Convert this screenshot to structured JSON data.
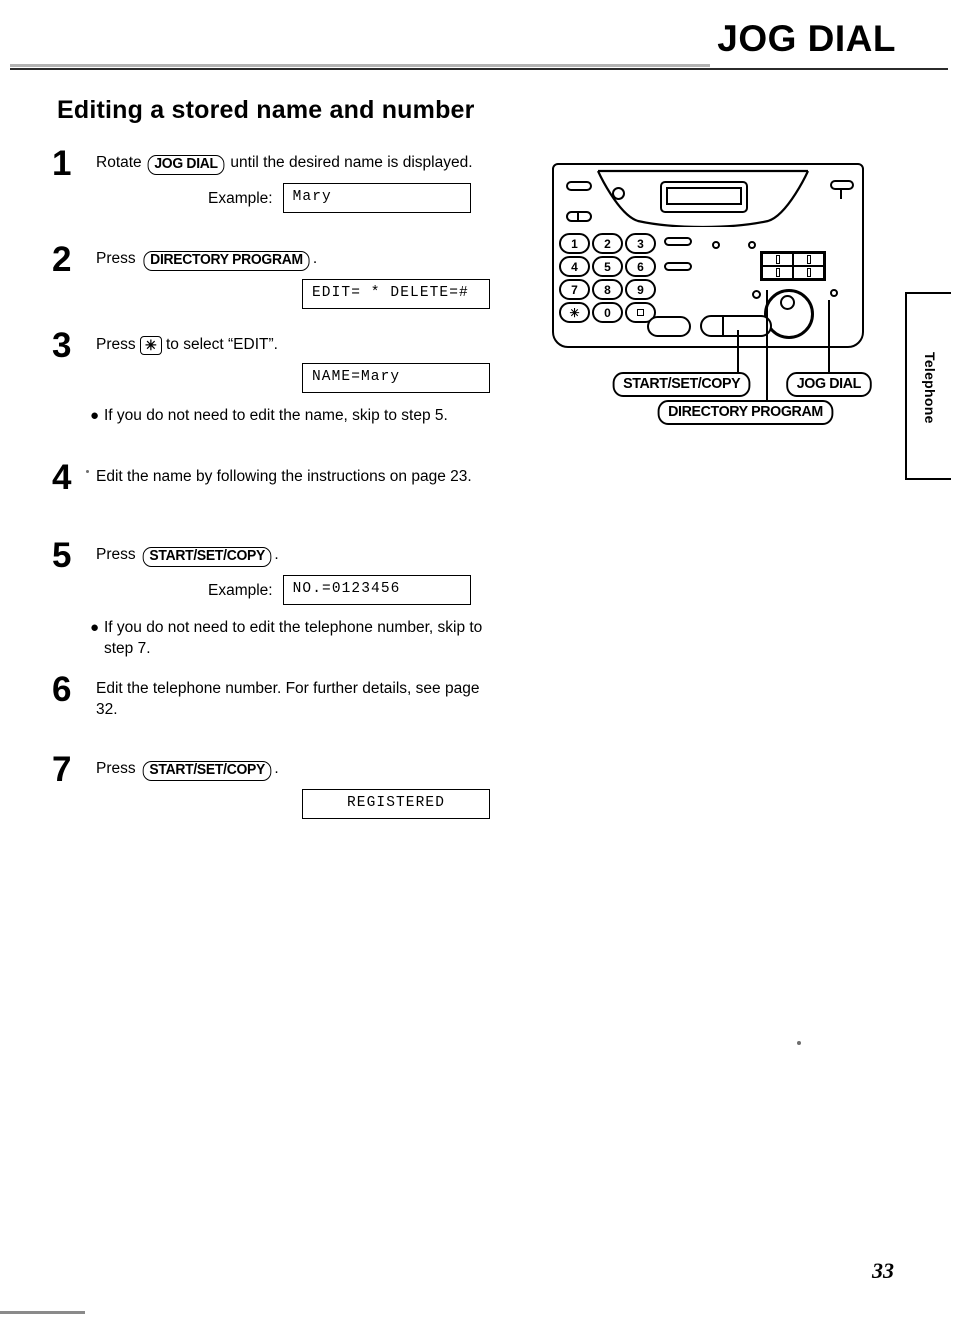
{
  "header": {
    "title": "JOG DIAL"
  },
  "section": {
    "title": "Editing a stored name and number"
  },
  "steps": [
    {
      "number": "1",
      "text_before": "Rotate",
      "key": "JOG DIAL",
      "text_after": "until the desired name is displayed.",
      "example_label": "Example:",
      "lcd": "Mary",
      "lcd_align": "left"
    },
    {
      "number": "2",
      "text_before": "Press",
      "key": "DIRECTORY PROGRAM",
      "text_after": ".",
      "lcd": "EDIT= * DELETE=#",
      "lcd_align": "left"
    },
    {
      "number": "3",
      "text_before": "Press",
      "key": "✳",
      "text_after": "to select “EDIT”.",
      "lcd": "NAME=Mary",
      "lcd_align": "left",
      "note": "If you do not need to edit the name, skip to step 5."
    },
    {
      "number": "4",
      "text_full": "Edit the name by following the instructions on page 23."
    },
    {
      "number": "5",
      "text_before": "Press",
      "key": "START/SET/COPY",
      "text_after": ".",
      "example_label": "Example:",
      "lcd": "NO.=0123456",
      "lcd_align": "left",
      "note": "If you do not need to edit the telephone number, skip to step 7."
    },
    {
      "number": "6",
      "text_full": "Edit the telephone number. For further details, see page 32."
    },
    {
      "number": "7",
      "text_before": "Press",
      "key": "START/SET/COPY",
      "text_after": ".",
      "lcd": "REGISTERED",
      "lcd_align": "center"
    }
  ],
  "device": {
    "keypad": [
      "1",
      "2",
      "3",
      "4",
      "5",
      "6",
      "7",
      "8",
      "9",
      "✳",
      "0",
      "#"
    ],
    "callouts": {
      "start_set_copy": "START/SET/COPY",
      "jog_dial": "JOG DIAL",
      "directory_program": "DIRECTORY PROGRAM"
    }
  },
  "side_tab": {
    "label": "Telephone"
  },
  "footer": {
    "page_number": "33"
  },
  "colors": {
    "ink": "#000000",
    "paper": "#ffffff",
    "scan_gray": "#8a8a8a"
  }
}
